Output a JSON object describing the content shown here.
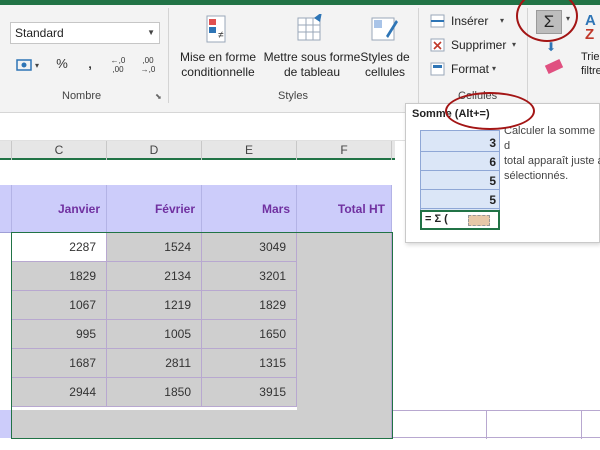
{
  "ribbon": {
    "number_format": "Standard",
    "group_number_label": "Nombre",
    "group_styles_label": "Styles",
    "group_cells_label": "Cellules",
    "number_buttons": [
      "%",
      "‚",
      "←,0\n,00",
      ",00\n→,0"
    ],
    "conditional_format": "Mise en forme\nconditionnelle",
    "table_format": "Mettre sous forme\nde tableau",
    "cell_styles": "Styles de\ncellules",
    "insert": "Insérer",
    "delete": "Supprimer",
    "format": "Format",
    "sort_filter": "Trier\nfiltre",
    "sigma": "Σ"
  },
  "columns": [
    "C",
    "D",
    "E",
    "F"
  ],
  "table": {
    "headers": [
      "Janvier",
      "Février",
      "Mars",
      "Total HT"
    ],
    "rows": [
      [
        "2287",
        "1524",
        "3049"
      ],
      [
        "1829",
        "2134",
        "3201"
      ],
      [
        "1067",
        "1219",
        "1829"
      ],
      [
        "995",
        "1005",
        "1650"
      ],
      [
        "1687",
        "2811",
        "1315"
      ],
      [
        "2944",
        "1850",
        "3915"
      ]
    ]
  },
  "tooltip": {
    "title": "Somme (Alt+=)",
    "description": "Calculer la somme d\ntotal apparaît juste a\nsélectionnés.",
    "values": [
      "3",
      "6",
      "5",
      "5"
    ],
    "formula": "= Σ ("
  },
  "colors": {
    "accent": "#217346",
    "header_bg": "#ccccfa",
    "header_text": "#7030a0",
    "selection": "#cfcfcf",
    "annotation": "#a31515"
  }
}
